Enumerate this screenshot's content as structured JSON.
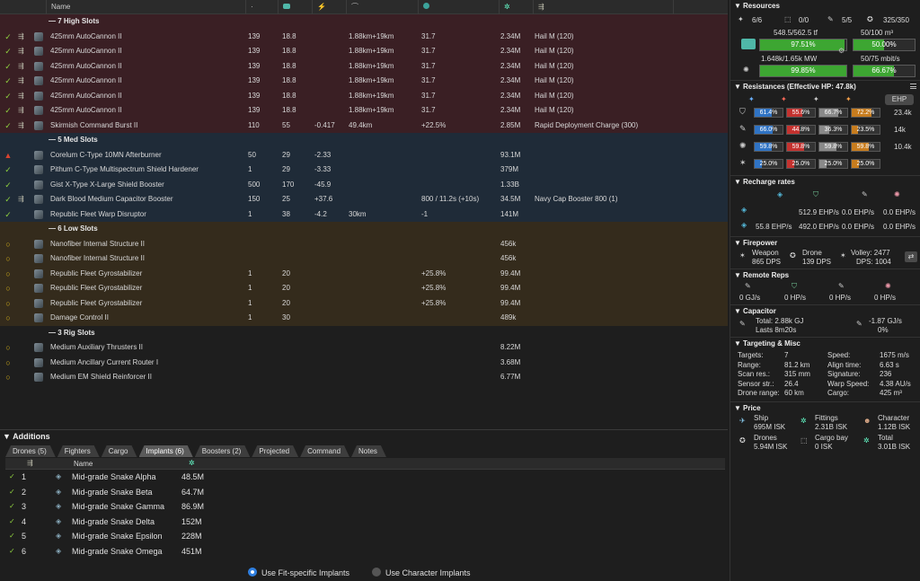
{
  "fitting": {
    "columns": [
      "Name"
    ],
    "sections": [
      {
        "key": "high",
        "header": "— 7 High Slots",
        "modules": [
          {
            "state": "✓",
            "name": "425mm AutoCannon II",
            "c1": "139",
            "c2": "18.8",
            "c3": "",
            "c4": "1.88km+19km",
            "c5": "31.7",
            "price": "2.34M",
            "charge": "Hail M (120)"
          },
          {
            "state": "✓",
            "name": "425mm AutoCannon II",
            "c1": "139",
            "c2": "18.8",
            "c3": "",
            "c4": "1.88km+19km",
            "c5": "31.7",
            "price": "2.34M",
            "charge": "Hail M (120)"
          },
          {
            "state": "✓",
            "name": "425mm AutoCannon II",
            "c1": "139",
            "c2": "18.8",
            "c3": "",
            "c4": "1.88km+19km",
            "c5": "31.7",
            "price": "2.34M",
            "charge": "Hail M (120)"
          },
          {
            "state": "✓",
            "name": "425mm AutoCannon II",
            "c1": "139",
            "c2": "18.8",
            "c3": "",
            "c4": "1.88km+19km",
            "c5": "31.7",
            "price": "2.34M",
            "charge": "Hail M (120)"
          },
          {
            "state": "✓",
            "name": "425mm AutoCannon II",
            "c1": "139",
            "c2": "18.8",
            "c3": "",
            "c4": "1.88km+19km",
            "c5": "31.7",
            "price": "2.34M",
            "charge": "Hail M (120)"
          },
          {
            "state": "✓",
            "name": "425mm AutoCannon II",
            "c1": "139",
            "c2": "18.8",
            "c3": "",
            "c4": "1.88km+19km",
            "c5": "31.7",
            "price": "2.34M",
            "charge": "Hail M (120)"
          },
          {
            "state": "✓",
            "name": "Skirmish Command Burst II",
            "c1": "110",
            "c2": "55",
            "c3": "-0.417",
            "c4": "49.4km",
            "c5": "+22.5%",
            "price": "2.85M",
            "charge": "Rapid Deployment Charge (300)"
          }
        ]
      },
      {
        "key": "med",
        "header": "— 5 Med Slots",
        "modules": [
          {
            "state": "▲",
            "name": "Corelum C-Type 10MN Afterburner",
            "c1": "50",
            "c2": "29",
            "c3": "-2.33",
            "c4": "",
            "c5": "",
            "price": "93.1M",
            "charge": ""
          },
          {
            "state": "✓",
            "name": "Pithum C-Type Multispectrum Shield Hardener",
            "c1": "1",
            "c2": "29",
            "c3": "-3.33",
            "c4": "",
            "c5": "",
            "price": "379M",
            "charge": ""
          },
          {
            "state": "✓",
            "name": "Gist X-Type X-Large Shield Booster",
            "c1": "500",
            "c2": "170",
            "c3": "-45.9",
            "c4": "",
            "c5": "",
            "price": "1.33B",
            "charge": ""
          },
          {
            "state": "✓",
            "name": "Dark Blood Medium Capacitor Booster",
            "c1": "150",
            "c2": "25",
            "c3": "+37.6",
            "c4": "",
            "c5": "800 / 11.2s (+10s)",
            "price": "34.5M",
            "charge": "Navy Cap Booster 800 (1)"
          },
          {
            "state": "✓",
            "name": "Republic Fleet Warp Disruptor",
            "c1": "1",
            "c2": "38",
            "c3": "-4.2",
            "c4": "30km",
            "c5": "-1",
            "price": "141M",
            "charge": ""
          }
        ]
      },
      {
        "key": "low",
        "header": "— 6 Low Slots",
        "modules": [
          {
            "state": "○",
            "name": "Nanofiber Internal Structure II",
            "c1": "",
            "c2": "",
            "c3": "",
            "c4": "",
            "c5": "",
            "price": "456k",
            "charge": ""
          },
          {
            "state": "○",
            "name": "Nanofiber Internal Structure II",
            "c1": "",
            "c2": "",
            "c3": "",
            "c4": "",
            "c5": "",
            "price": "456k",
            "charge": ""
          },
          {
            "state": "○",
            "name": "Republic Fleet Gyrostabilizer",
            "c1": "1",
            "c2": "20",
            "c3": "",
            "c4": "",
            "c5": "+25.8%",
            "price": "99.4M",
            "charge": ""
          },
          {
            "state": "○",
            "name": "Republic Fleet Gyrostabilizer",
            "c1": "1",
            "c2": "20",
            "c3": "",
            "c4": "",
            "c5": "+25.8%",
            "price": "99.4M",
            "charge": ""
          },
          {
            "state": "○",
            "name": "Republic Fleet Gyrostabilizer",
            "c1": "1",
            "c2": "20",
            "c3": "",
            "c4": "",
            "c5": "+25.8%",
            "price": "99.4M",
            "charge": ""
          },
          {
            "state": "○",
            "name": "Damage Control II",
            "c1": "1",
            "c2": "30",
            "c3": "",
            "c4": "",
            "c5": "",
            "price": "489k",
            "charge": ""
          }
        ]
      },
      {
        "key": "rig",
        "header": "— 3 Rig Slots",
        "modules": [
          {
            "state": "○",
            "name": "Medium Auxiliary Thrusters II",
            "c1": "",
            "c2": "",
            "c3": "",
            "c4": "",
            "c5": "",
            "price": "8.22M",
            "charge": ""
          },
          {
            "state": "○",
            "name": "Medium Ancillary Current Router I",
            "c1": "",
            "c2": "",
            "c3": "",
            "c4": "",
            "c5": "",
            "price": "3.68M",
            "charge": ""
          },
          {
            "state": "○",
            "name": "Medium EM Shield Reinforcer II",
            "c1": "",
            "c2": "",
            "c3": "",
            "c4": "",
            "c5": "",
            "price": "6.77M",
            "charge": ""
          }
        ]
      }
    ]
  },
  "additions": {
    "title": "Additions",
    "tabs": [
      "Drones (5)",
      "Fighters",
      "Cargo",
      "Implants (6)",
      "Boosters (2)",
      "Projected",
      "Command",
      "Notes"
    ],
    "active_tab": 3,
    "name_header": "Name",
    "implants": [
      {
        "slot": "1",
        "name": "Mid-grade Snake Alpha",
        "price": "48.5M"
      },
      {
        "slot": "2",
        "name": "Mid-grade Snake Beta",
        "price": "64.7M"
      },
      {
        "slot": "3",
        "name": "Mid-grade Snake Gamma",
        "price": "86.9M"
      },
      {
        "slot": "4",
        "name": "Mid-grade Snake Delta",
        "price": "152M"
      },
      {
        "slot": "5",
        "name": "Mid-grade Snake Epsilon",
        "price": "228M"
      },
      {
        "slot": "6",
        "name": "Mid-grade Snake Omega",
        "price": "451M"
      }
    ],
    "radio_fit": "Use Fit-specific Implants",
    "radio_char": "Use Character Implants"
  },
  "resources": {
    "title": "Resources",
    "turrets": "6/6",
    "launchers": "0/0",
    "calibration": "5/5",
    "drone_bay": "325/350",
    "cpu_text": "548.5/562.5 tf",
    "cpu_pct": "97.51%",
    "cpu_fill": 97.51,
    "dronebw_text": "50/100 m³",
    "dronebw_pct": "50.00%",
    "dronebw_fill": 50,
    "pg_text": "1.648k/1.65k MW",
    "pg_pct": "99.85%",
    "pg_fill": 99.85,
    "bandwidth_text": "50/75 mbit/s",
    "bandwidth_pct": "66.67%",
    "bandwidth_fill": 66.67
  },
  "resistances": {
    "title": "Resistances (Effective HP: 47.8k)",
    "ehp_button": "EHP",
    "rows": [
      {
        "layer": "shield",
        "em": "61.4%",
        "th": "55.6%",
        "kin": "66.7%",
        "exp": "72.2%",
        "hp": "23.4k",
        "f": [
          61.4,
          55.6,
          66.7,
          72.2
        ]
      },
      {
        "layer": "armor",
        "em": "66.0%",
        "th": "44.8%",
        "kin": "36.3%",
        "exp": "23.5%",
        "hp": "14k",
        "f": [
          66.0,
          44.8,
          36.3,
          23.5
        ]
      },
      {
        "layer": "hull",
        "em": "59.8%",
        "th": "59.8%",
        "kin": "59.8%",
        "exp": "59.8%",
        "hp": "10.4k",
        "f": [
          59.8,
          59.8,
          59.8,
          59.8
        ]
      },
      {
        "layer": "damage",
        "em": "25.0%",
        "th": "25.0%",
        "kin": "25.0%",
        "exp": "25.0%",
        "hp": "",
        "f": [
          25,
          25,
          25,
          25
        ]
      }
    ]
  },
  "recharge": {
    "title": "Recharge rates",
    "r1": [
      "512.9 EHP/s",
      "0.0 EHP/s",
      "0.0 EHP/s"
    ],
    "r2": [
      "55.8 EHP/s",
      "492.0 EHP/s",
      "0.0 EHP/s",
      "0.0 EHP/s"
    ]
  },
  "firepower": {
    "title": "Firepower",
    "weapon_label": "Weapon",
    "weapon_dps": "865 DPS",
    "drone_label": "Drone",
    "drone_dps": "139 DPS",
    "volley": "Volley: 2477",
    "dps": "DPS: 1004"
  },
  "remote": {
    "title": "Remote Reps",
    "values": [
      "0 GJ/s",
      "0 HP/s",
      "0 HP/s",
      "0 HP/s"
    ]
  },
  "capacitor": {
    "title": "Capacitor",
    "total": "Total: 2.88k GJ",
    "lasts": "Lasts 8m20s",
    "delta": "-1.87 GJ/s",
    "pct": "0%"
  },
  "targeting": {
    "title": "Targeting & Misc",
    "left": [
      [
        "Targets:",
        "7"
      ],
      [
        "Range:",
        "81.2 km"
      ],
      [
        "Scan res.:",
        "315 mm"
      ],
      [
        "Sensor str.:",
        "26.4"
      ],
      [
        "Drone range:",
        "60 km"
      ]
    ],
    "right": [
      [
        "Speed:",
        "1675 m/s"
      ],
      [
        "Align time:",
        "6.63 s"
      ],
      [
        "Signature:",
        "236"
      ],
      [
        "Warp Speed:",
        "4.38 AU/s"
      ],
      [
        "Cargo:",
        "425 m³"
      ]
    ]
  },
  "price": {
    "title": "Price",
    "ship_label": "Ship",
    "ship": "695M ISK",
    "fittings_label": "Fittings",
    "fittings": "2.31B ISK",
    "character_label": "Character",
    "character": "1.12B ISK",
    "drones_label": "Drones",
    "drones": "5.94M ISK",
    "cargo_label": "Cargo bay",
    "cargo": "0 ISK",
    "total_label": "Total",
    "total": "3.01B ISK"
  },
  "colors": {
    "em": "#2f73c4",
    "th": "#c4322f",
    "kin": "#8a8a8a",
    "exp": "#c77c1e",
    "green": "#3da632"
  }
}
